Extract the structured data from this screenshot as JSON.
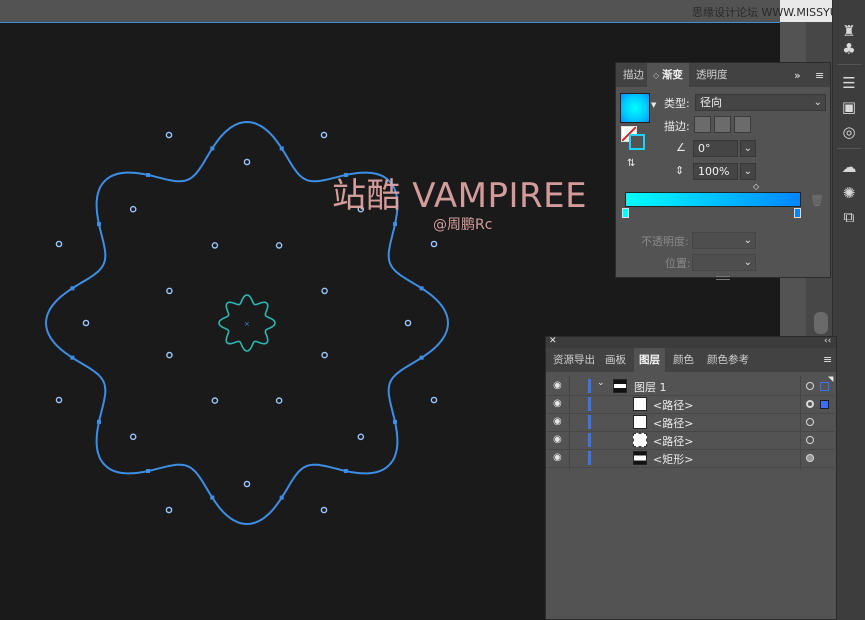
{
  "watermark": {
    "site": "思缘设计论坛 WWW.MISSYUAN.COM",
    "title": "站酷 VAMPIREE",
    "author": "@周鹏Rc"
  },
  "gradient_panel": {
    "tabs": [
      "描边",
      "渐变",
      "透明度"
    ],
    "active_tab": "渐变",
    "type_label": "类型:",
    "type_value": "径向",
    "stroke_label": "描边:",
    "angle_value": "0°",
    "aspect_value": "100%",
    "opacity_label": "不透明度:",
    "position_label": "位置:",
    "gradient_colors": {
      "start": "#00ffff",
      "end": "#0086ff"
    }
  },
  "layers_panel": {
    "tabs": [
      "资源导出",
      "画板",
      "图层",
      "颜色",
      "颜色参考"
    ],
    "active_tab": "图层",
    "rows": [
      {
        "label": "图层 1"
      },
      {
        "label": "<路径>"
      },
      {
        "label": "<路径>"
      },
      {
        "label": "<路径>"
      },
      {
        "label": "<矩形>"
      }
    ]
  },
  "colors": {
    "selection_blue": "#3e8ee6",
    "inner_shape": "#2bb7b0",
    "watermark": "#e3a7a6"
  }
}
